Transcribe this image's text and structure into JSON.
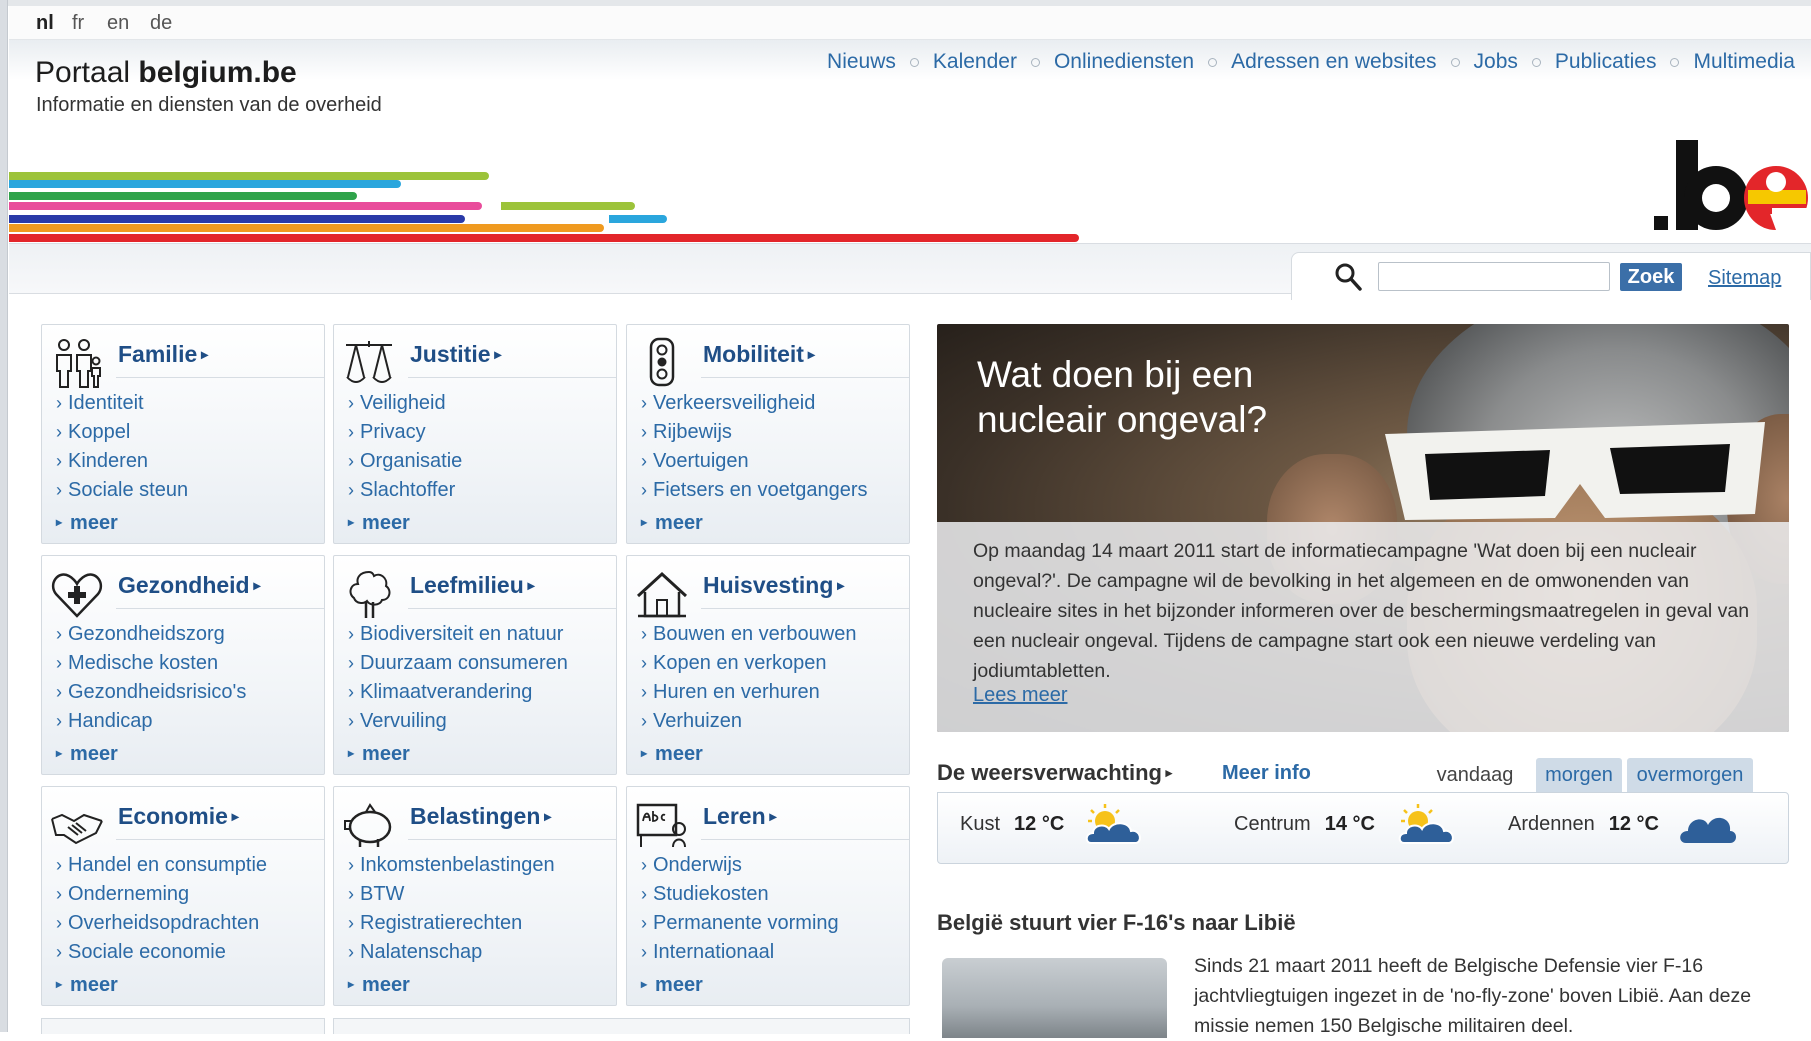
{
  "languages": {
    "nl": "nl",
    "fr": "fr",
    "en": "en",
    "de": "de"
  },
  "brand": {
    "title_prefix": "Portaal ",
    "title_bold": "belgium.be",
    "subtitle": "Informatie en diensten van de overheid",
    "logo_text": ".be"
  },
  "topnav": [
    "Nieuws",
    "Kalender",
    "Onlinediensten",
    "Adressen en websites",
    "Jobs",
    "Publicaties",
    "Multimedia"
  ],
  "search": {
    "button": "Zoek",
    "sitemap": "Sitemap"
  },
  "categories": [
    {
      "title": "Familie",
      "icon": "family-icon",
      "items": [
        "Identiteit",
        "Koppel",
        "Kinderen",
        "Sociale steun"
      ],
      "more": "meer"
    },
    {
      "title": "Justitie",
      "icon": "scales-icon",
      "items": [
        "Veiligheid",
        "Privacy",
        "Organisatie",
        "Slachtoffer"
      ],
      "more": "meer"
    },
    {
      "title": "Mobiliteit",
      "icon": "traffic-light-icon",
      "items": [
        "Verkeersveiligheid",
        "Rijbewijs",
        "Voertuigen",
        "Fietsers en voetgangers"
      ],
      "more": "meer"
    },
    {
      "title": "Gezondheid",
      "icon": "heart-icon",
      "items": [
        "Gezondheidszorg",
        "Medische kosten",
        "Gezondheidsrisico's",
        "Handicap"
      ],
      "more": "meer"
    },
    {
      "title": "Leefmilieu",
      "icon": "tree-icon",
      "items": [
        "Biodiversiteit en natuur",
        "Duurzaam consumeren",
        "Klimaatverandering",
        "Vervuiling"
      ],
      "more": "meer"
    },
    {
      "title": "Huisvesting",
      "icon": "house-icon",
      "items": [
        "Bouwen en verbouwen",
        "Kopen en verkopen",
        "Huren en verhuren",
        "Verhuizen"
      ],
      "more": "meer"
    },
    {
      "title": "Economie",
      "icon": "handshake-icon",
      "items": [
        "Handel en consumptie",
        "Onderneming",
        "Overheidsopdrachten",
        "Sociale economie"
      ],
      "more": "meer"
    },
    {
      "title": "Belastingen",
      "icon": "piggy-bank-icon",
      "items": [
        "Inkomstenbelastingen",
        "BTW",
        "Registratierechten",
        "Nalatenschap"
      ],
      "more": "meer"
    },
    {
      "title": "Leren",
      "icon": "abc-board-icon",
      "items": [
        "Onderwijs",
        "Studiekosten",
        "Permanente vorming",
        "Internationaal"
      ],
      "more": "meer"
    }
  ],
  "feature": {
    "title": "Wat doen bij een nucleair ongeval?",
    "body": "Op maandag 14 maart 2011 start de informatiecampagne 'Wat doen bij een nucleair ongeval?'. De campagne wil de bevolking in het algemeen en de omwonenden van nucleaire sites in het bijzonder informeren over de beschermingsmaatregelen in geval van een nucleair ongeval. Tijdens de campagne start ook een nieuwe verdeling van jodiumtabletten.",
    "link": "Lees meer"
  },
  "weather": {
    "title": "De weersverwachting",
    "more": "Meer info",
    "tabs": [
      "vandaag",
      "morgen",
      "overmorgen"
    ],
    "regions": [
      {
        "name": "Kust",
        "temp": "12 °C",
        "icon": "sun-cloud-icon"
      },
      {
        "name": "Centrum",
        "temp": "14 °C",
        "icon": "sun-cloud-icon"
      },
      {
        "name": "Ardennen",
        "temp": "12 °C",
        "icon": "cloud-icon"
      }
    ]
  },
  "news": {
    "title": "België stuurt vier F-16's naar Libië",
    "body": "Sinds 21 maart 2011 heeft de Belgische Defensie vier F-16 jachtvliegtuigen ingezet in de 'no-fly-zone' boven Libië. Aan deze missie nemen 150 Belgische militairen deel."
  },
  "colors": {
    "link": "#2c6aa6",
    "heading": "#1f4e86",
    "search_button": "#3b6fa8",
    "tab_inactive": "#cfdbe7"
  }
}
